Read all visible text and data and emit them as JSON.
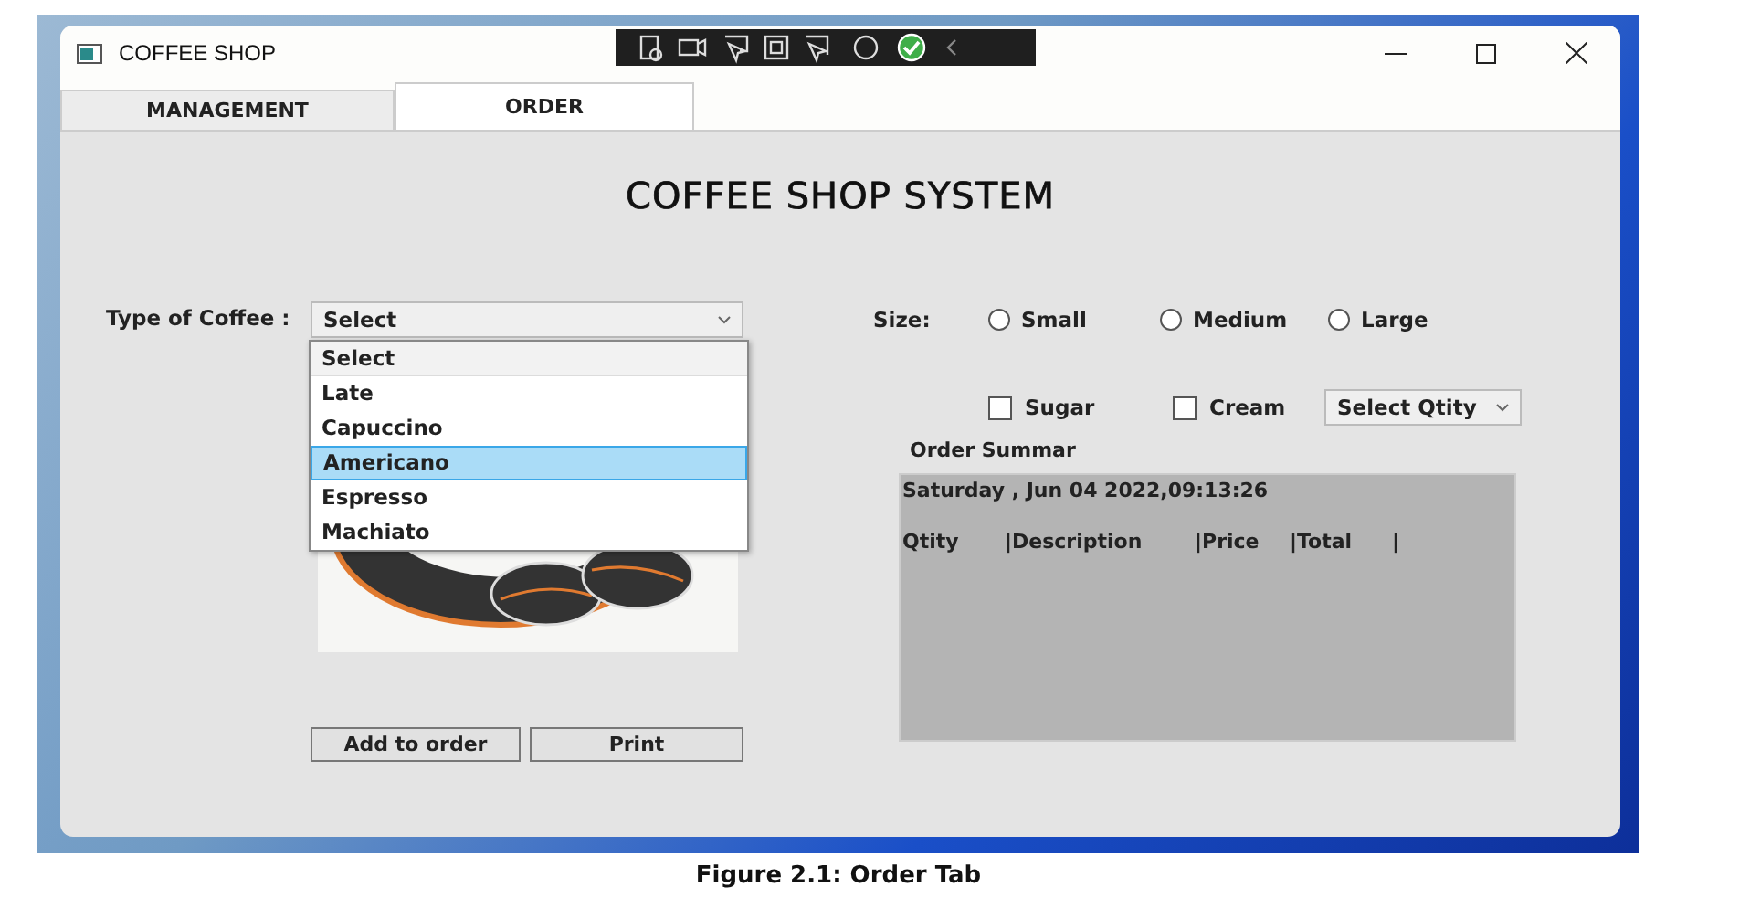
{
  "window": {
    "title": "COFFEE SHOP"
  },
  "tabs": [
    {
      "label": "MANAGEMENT",
      "selected": false
    },
    {
      "label": "ORDER",
      "selected": true
    }
  ],
  "heading": "COFFEE SHOP SYSTEM",
  "coffee_type": {
    "label": "Type of Coffee :",
    "value": "Select",
    "expanded": true,
    "options": [
      {
        "label": "Select",
        "selected": true,
        "highlighted": false
      },
      {
        "label": "Late",
        "selected": false,
        "highlighted": false
      },
      {
        "label": "Capuccino",
        "selected": false,
        "highlighted": false
      },
      {
        "label": "Americano",
        "selected": false,
        "highlighted": true
      },
      {
        "label": "Espresso",
        "selected": false,
        "highlighted": false
      },
      {
        "label": "Machiato",
        "selected": false,
        "highlighted": false
      }
    ]
  },
  "size": {
    "label": "Size:",
    "options": [
      {
        "label": "Small",
        "selected": false
      },
      {
        "label": "Medium",
        "selected": false
      },
      {
        "label": "Large",
        "selected": false
      }
    ]
  },
  "extras": [
    {
      "label": "Sugar",
      "checked": false
    },
    {
      "label": "Cream",
      "checked": false
    }
  ],
  "quantity": {
    "value": "Select Qtity"
  },
  "order_summary": {
    "title": "Order Summar",
    "date": "Saturday , Jun 04 2022,09:13:26",
    "columns": [
      "Qtity",
      "|Description",
      "|Price",
      "|Total",
      "|"
    ]
  },
  "buttons": [
    "Add to order",
    "Print"
  ],
  "caption": "Figure 2.1:  Order Tab"
}
